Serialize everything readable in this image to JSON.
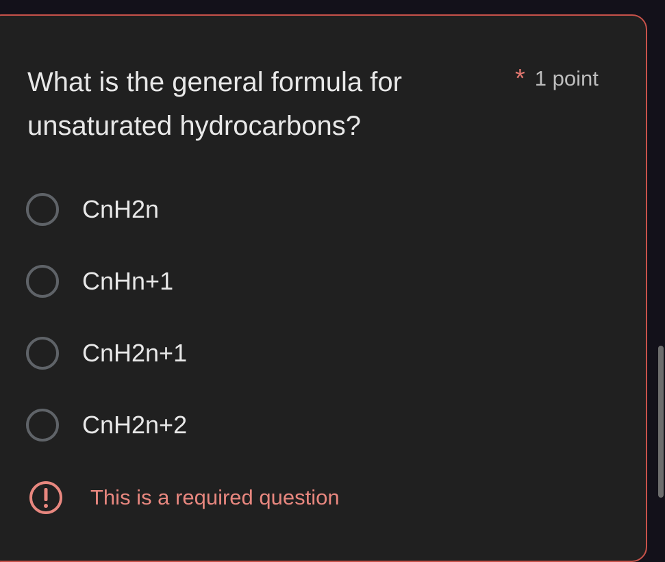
{
  "question": {
    "title": "What is the general formula for unsaturated hydrocarbons?",
    "required_mark": "*",
    "points": "1 point"
  },
  "options": [
    {
      "label": "CnH2n"
    },
    {
      "label": "CnHn+1"
    },
    {
      "label": "CnH2n+1"
    },
    {
      "label": "CnH2n+2"
    }
  ],
  "error": {
    "message": "This is a required question",
    "icon": "exclamation-circle-icon"
  },
  "colors": {
    "card_background": "#202020",
    "card_border": "#c8524a",
    "error": "#e8877f",
    "radio_border": "#5f6368"
  }
}
